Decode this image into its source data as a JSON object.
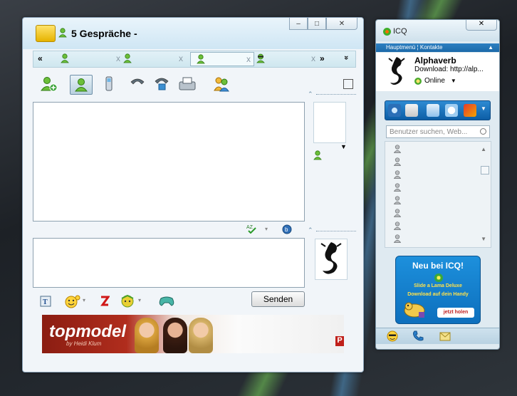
{
  "conversation": {
    "title": "5 Gespräche -",
    "window_controls": {
      "minimize": "–",
      "maximize": "□",
      "close": "✕"
    },
    "tabs": {
      "prev_label": "«",
      "next_label": "»",
      "overflow_label": "»",
      "close_glyph": "x",
      "items": [
        {
          "icon": "user-green-icon",
          "active": false
        },
        {
          "icon": "user-green-icon",
          "active": false
        },
        {
          "icon": "user-green-icon",
          "active": true
        },
        {
          "icon": "user-sunglasses-icon",
          "active": false
        }
      ]
    },
    "toolbar_icons": [
      "add-contact-icon",
      "user-info-icon",
      "mobile-phone-icon",
      "call-icon",
      "voip-icon",
      "fax-icon",
      "group-icon"
    ],
    "format_icons": [
      "font-icon",
      "smiley-icon",
      "zap-icon",
      "emoticons-icon",
      "games-icon"
    ],
    "send_label": "Senden",
    "ad": {
      "logo": "topmodel",
      "sub": "by Heidi Klum",
      "corner": "P"
    }
  },
  "icq": {
    "title": "ICQ",
    "close": "✕",
    "menu_label": "Hauptmenü ¦ Kontakte",
    "profile": {
      "name": "Alphaverb",
      "download": "Download: http://alp...",
      "status": "Online"
    },
    "search_placeholder": "Benutzer suchen, Web...",
    "contacts_count": 8,
    "promo": {
      "title": "Neu bei ICQ!",
      "line1": "Slide a Lama Deluxe",
      "line2": "Download auf dein Handy",
      "button": "jetzt holen"
    },
    "bottom_icons": [
      "smiley-icon",
      "phone-icon",
      "mail-icon"
    ],
    "colors": {
      "accent": "#1c6aa9",
      "status_online": "#4cab2e"
    }
  }
}
